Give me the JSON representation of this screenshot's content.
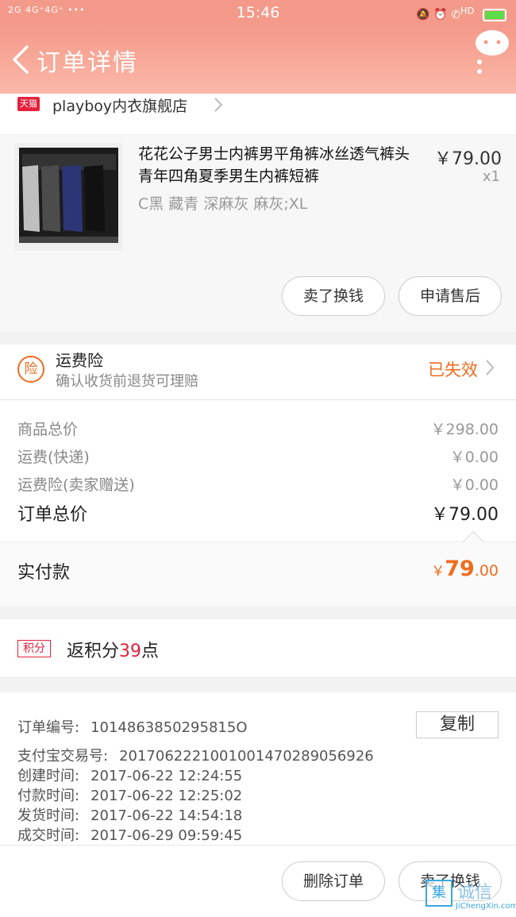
{
  "status_bar": {
    "signals": "2G 4G⁺4G⁺ •••",
    "time": "15:46",
    "icons": [
      "mute-icon",
      "alarm-icon",
      "hd-call-icon",
      "battery-icon"
    ],
    "hd_label": "HD"
  },
  "nav": {
    "title": "订单详情",
    "back_icon": "back-chevron-icon",
    "assistant_icon": "chat-bot-icon"
  },
  "shop": {
    "badge": "天猫",
    "name": "playboy内衣旗舰店"
  },
  "product": {
    "title": "花花公子男士内裤男平角裤冰丝透气裤头青年四角夏季男生内裤短裤",
    "sku": "C黑  藏青  深麻灰  麻灰;XL",
    "price": "￥79.00",
    "qty": "x1",
    "buttons": [
      "卖了换钱",
      "申请售后"
    ]
  },
  "insurance": {
    "icon_label": "险",
    "title": "运费险",
    "subtitle": "确认收货前退货可理赔",
    "status": "已失效"
  },
  "summary": {
    "rows": [
      {
        "label": "商品总价",
        "value": "￥298.00"
      },
      {
        "label": "运费(快递)",
        "value": "￥0.00"
      },
      {
        "label": "运费险(卖家赠送)",
        "value": "￥0.00"
      }
    ],
    "total_label": "订单总价",
    "total_value": "￥79.00"
  },
  "paid": {
    "label": "实付款",
    "currency": "￥",
    "integer": "79",
    "decimal": ".00"
  },
  "points": {
    "badge": "积分",
    "prefix": "返积分",
    "count": "39",
    "suffix": "点"
  },
  "order_info": {
    "copy_label": "复制",
    "lines": [
      {
        "label": "订单编号:",
        "value": "1014863850295815O"
      },
      {
        "label": "支付宝交易号:",
        "value": "2017062221001001470289056926"
      },
      {
        "label": "创建时间:",
        "value": "2017-06-22  12:24:55"
      },
      {
        "label": "付款时间:",
        "value": "2017-06-22  12:25:02"
      },
      {
        "label": "发货时间:",
        "value": "2017-06-22  14:54:18"
      },
      {
        "label": "成交时间:",
        "value": "2017-06-29  09:59:45"
      }
    ]
  },
  "bottom_bar": {
    "buttons": [
      "删除订单",
      "卖了换钱"
    ]
  },
  "watermark": {
    "mark": "集",
    "text": "诚信",
    "url": "JiChengXin.com"
  },
  "colors": {
    "header": "#f49a8a",
    "accent_orange": "#f06c1e",
    "accent_red": "#e4203c"
  }
}
